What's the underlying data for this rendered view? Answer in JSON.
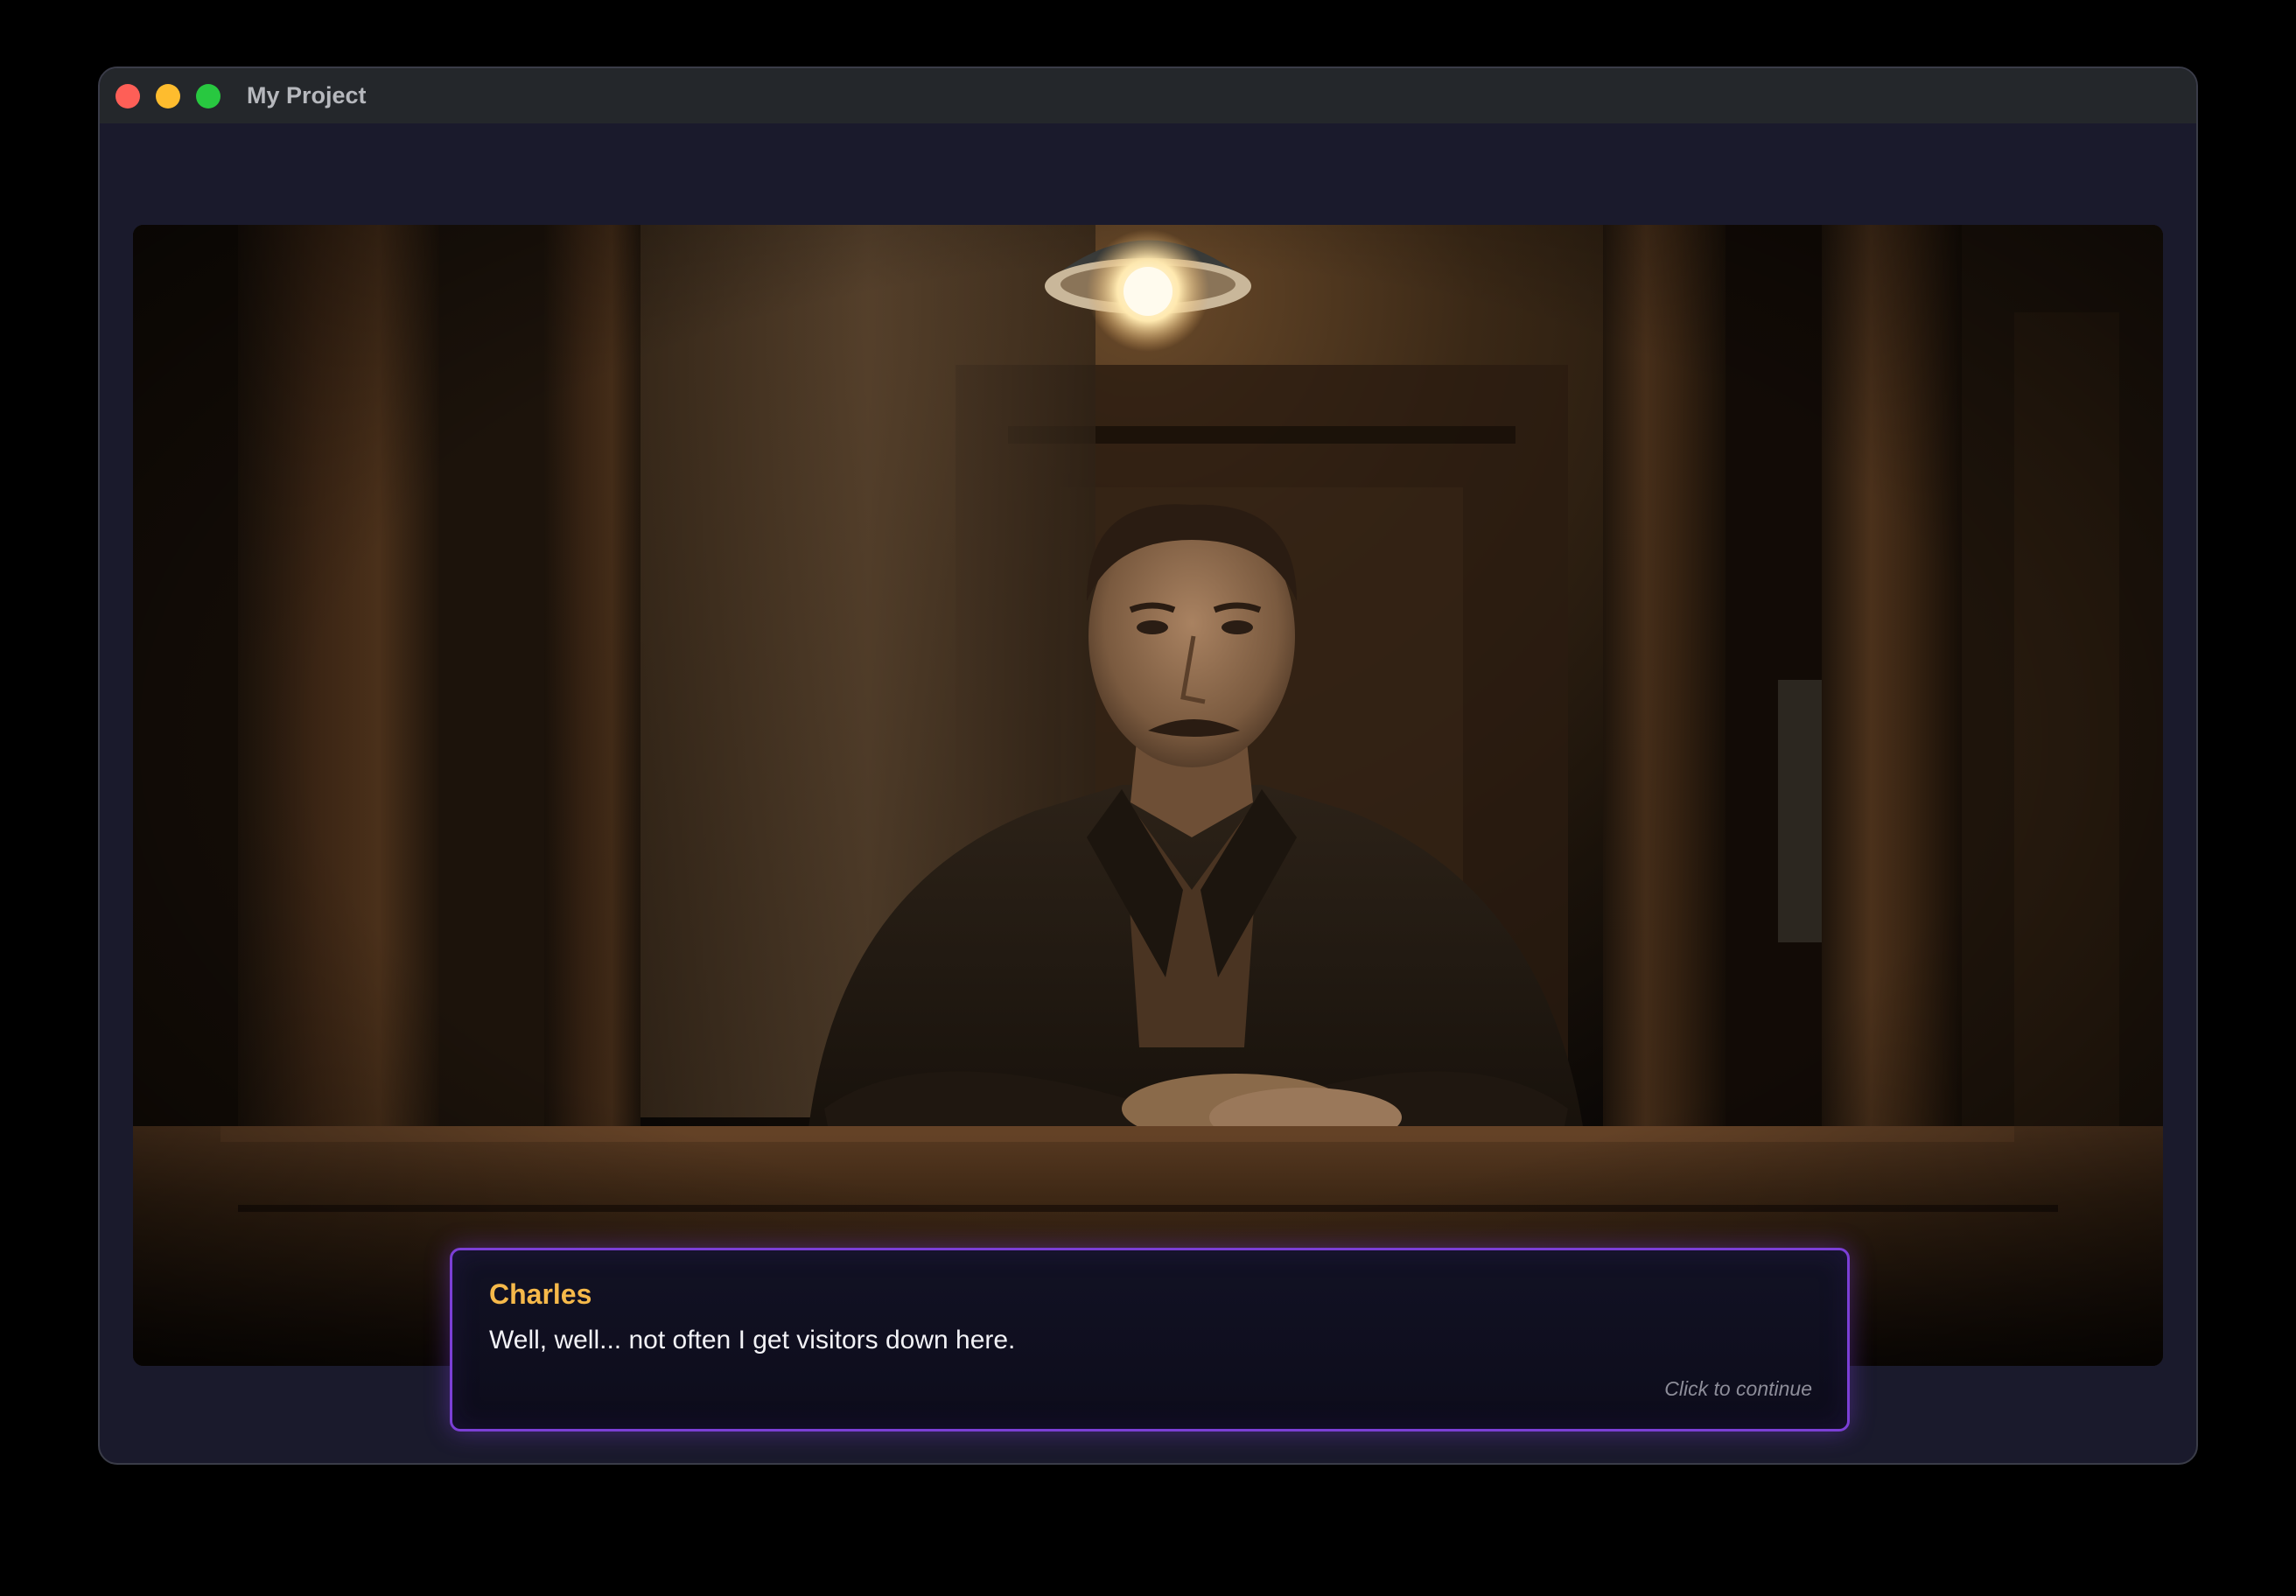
{
  "window": {
    "title": "My Project"
  },
  "scene": {
    "description_icon": "interrogation-room-scene"
  },
  "dialogue": {
    "speaker": "Charles",
    "text": "Well, well... not often I get visitors down here.",
    "prompt": "Click to continue"
  },
  "colors": {
    "speaker": "#f6b94a",
    "dialogue_border": "#7b3fd6",
    "window_bg": "#1a1a2c",
    "titlebar_bg": "#24272b"
  }
}
